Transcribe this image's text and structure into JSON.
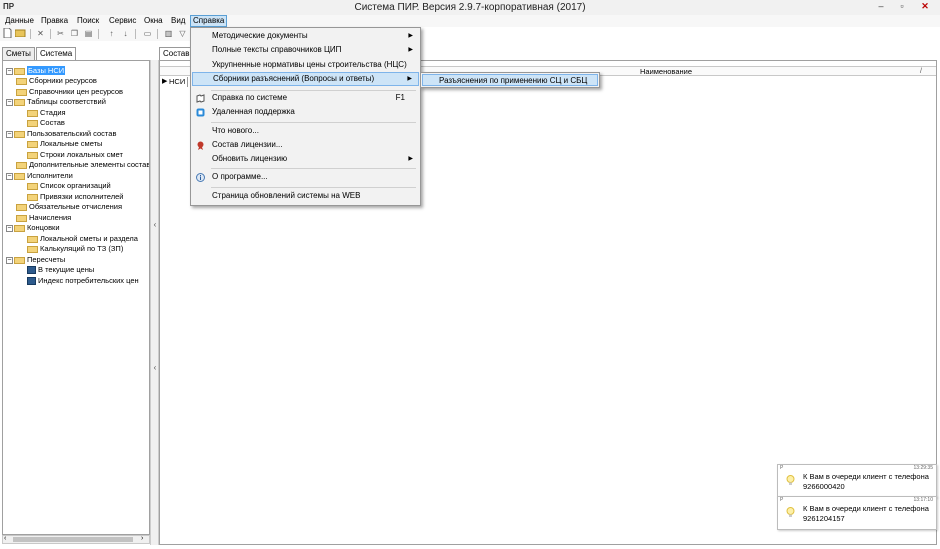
{
  "window": {
    "app_icon": "ПР",
    "title": "Система ПИР. Версия 2.9.7-корпоративная (2017)",
    "min": "–",
    "max": "▫",
    "close": "✕"
  },
  "menubar": [
    "Данные",
    "Правка",
    "Поиск",
    "Сервис",
    "Окна",
    "Вид",
    "Справка"
  ],
  "toolbar_icons": [
    "new-doc-icon",
    "open-folder-icon",
    "delete-icon",
    "cut-icon",
    "copy-icon",
    "paste-icon",
    "arrow-up-icon",
    "arrow-down-icon",
    "print-icon",
    "column-icon",
    "filter-icon"
  ],
  "left_tabs": [
    "Сметы",
    "Система"
  ],
  "tree": [
    {
      "label": "Базы НСИ",
      "expander": "–",
      "icon": "folder",
      "selected": true
    },
    {
      "label": "Сборники ресурсов",
      "expander": "",
      "icon": "folder"
    },
    {
      "label": "Справочники цен ресурсов",
      "expander": "",
      "icon": "folder"
    },
    {
      "label": "Таблицы соответствий",
      "expander": "–",
      "icon": "folder"
    },
    {
      "label": "Стадия",
      "expander": "",
      "icon": "folder"
    },
    {
      "label": "Состав",
      "expander": "",
      "icon": "folder"
    },
    {
      "label": "Пользовательский состав",
      "expander": "–",
      "icon": "folder"
    },
    {
      "label": "Локальные сметы",
      "expander": "",
      "icon": "folder"
    },
    {
      "label": "Строки локальных смет",
      "expander": "",
      "icon": "folder"
    },
    {
      "label": "Дополнительные элементы состав",
      "expander": "",
      "icon": "folder"
    },
    {
      "label": "Исполнители",
      "expander": "–",
      "icon": "folder"
    },
    {
      "label": "Список организаций",
      "expander": "",
      "icon": "folder"
    },
    {
      "label": "Привязки исполнителей",
      "expander": "",
      "icon": "folder"
    },
    {
      "label": "Обязательные отчисления",
      "expander": "",
      "icon": "folder"
    },
    {
      "label": "Начисления",
      "expander": "",
      "icon": "folder"
    },
    {
      "label": "Концовки",
      "expander": "–",
      "icon": "folder"
    },
    {
      "label": "Локальной сметы и раздела",
      "expander": "",
      "icon": "folder"
    },
    {
      "label": "Калькуляций по ТЗ (ЗП)",
      "expander": "",
      "icon": "folder"
    },
    {
      "label": "Пересчеты",
      "expander": "–",
      "icon": "folder"
    },
    {
      "label": "В текущие цены",
      "expander": "",
      "icon": "calc"
    },
    {
      "label": "Индекс потребительских цен",
      "expander": "",
      "icon": "calc"
    }
  ],
  "right": {
    "tab": "Состав",
    "column_name": "Наименование",
    "column_sort": "/",
    "row_pointer": "▶",
    "row_cell": "НСИ"
  },
  "dropdown": [
    {
      "label": "Методические документы",
      "arrow": "▶",
      "icon": "",
      "shortcut": ""
    },
    {
      "label": "Полные тексты справочников ЦИП",
      "arrow": "▶",
      "icon": "",
      "shortcut": ""
    },
    {
      "label": "Укрупненные нормативы цены строительства (НЦС)",
      "arrow": "",
      "icon": "",
      "shortcut": ""
    },
    {
      "label": "Сборники разъяснений (Вопросы и ответы)",
      "arrow": "▶",
      "icon": "",
      "shortcut": "",
      "highlighted": true
    },
    {
      "label": "Справка по системе",
      "arrow": "",
      "icon": "help-book-icon",
      "shortcut": "F1"
    },
    {
      "label": "Удаленная поддержка",
      "arrow": "",
      "icon": "remote-support-icon",
      "shortcut": ""
    },
    {
      "label": "Что нового...",
      "arrow": "",
      "icon": "",
      "shortcut": ""
    },
    {
      "label": "Состав лицензии...",
      "arrow": "",
      "icon": "license-ribbon-icon",
      "shortcut": ""
    },
    {
      "label": "Обновить лицензию",
      "arrow": "▶",
      "icon": "",
      "shortcut": ""
    },
    {
      "label": "О программе...",
      "arrow": "",
      "icon": "info-icon",
      "shortcut": ""
    },
    {
      "label": "Страница обновлений системы  на WEB",
      "arrow": "",
      "icon": "",
      "shortcut": ""
    }
  ],
  "submenu": {
    "label": "Разъяснения по применению СЦ и СБЦ"
  },
  "notifications": [
    {
      "p": "P",
      "time": "13:29:35",
      "text": "К Вам в очереди клиент с телефона",
      "phone": "9266000420"
    },
    {
      "p": "P",
      "time": "13:17:10",
      "text": "К Вам в очереди клиент с телефона",
      "phone": "9261204157"
    }
  ],
  "colors": {
    "accent": "#3399ff",
    "menu_highlight": "#cde4f7",
    "folder": "#f3d37a"
  }
}
